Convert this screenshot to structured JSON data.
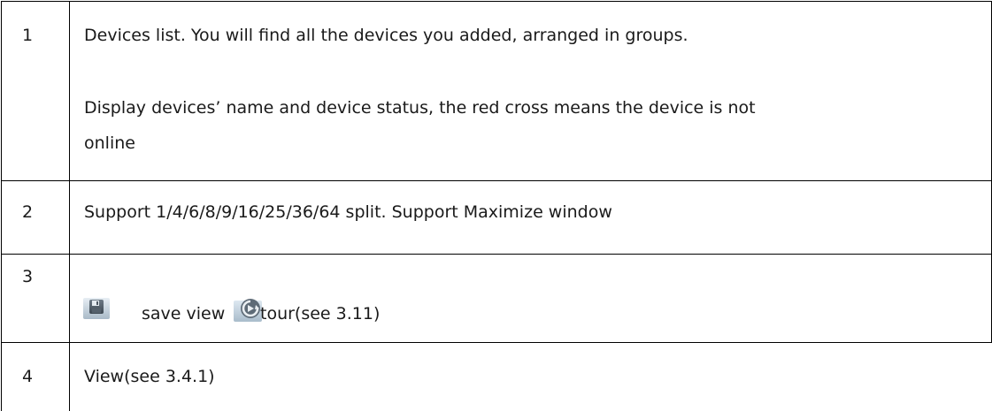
{
  "rows": [
    {
      "number": "1",
      "lines": [
        "Devices list. You will find all the devices you added, arranged in groups.",
        "Display devices’ name and device status, the red cross means the device is not",
        "online"
      ]
    },
    {
      "number": "2",
      "lines": [
        "Support 1/4/6/8/9/16/25/36/64 split. Support Maximize window"
      ]
    },
    {
      "number": "3",
      "save_label": "save view",
      "save_icon": "floppy-disk-icon",
      "tour_label": "tour(see 3.11)",
      "tour_icon": "tour-play-icon"
    },
    {
      "number": "4",
      "lines": [
        "View(see 3.4.1)"
      ]
    }
  ]
}
